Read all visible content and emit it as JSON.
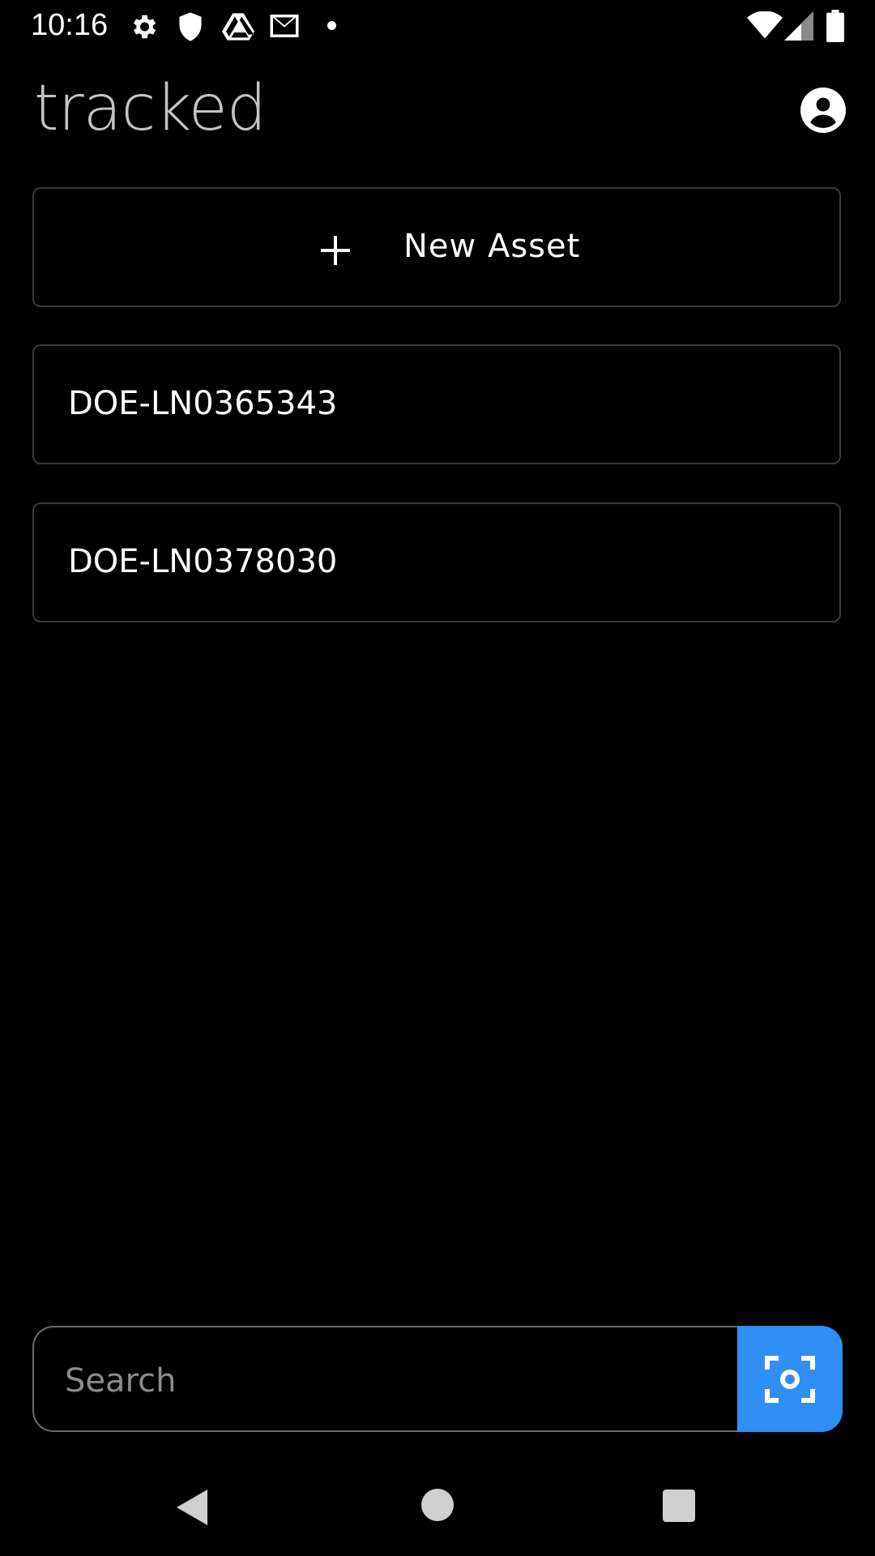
{
  "status_bar": {
    "time": "10:16",
    "left_icons": [
      "gear-icon",
      "shield-icon",
      "drive-icon",
      "gmail-icon",
      "dot-icon"
    ],
    "right_icons": [
      "wifi-icon",
      "signal-icon",
      "battery-icon"
    ]
  },
  "app_bar": {
    "title": "tracked",
    "profile_icon": "account-circle-icon"
  },
  "actions": {
    "new_asset_label": "New Asset",
    "new_asset_icon": "plus-icon"
  },
  "assets": [
    {
      "label": "DOE-LN0365343"
    },
    {
      "label": "DOE-LN0378030"
    }
  ],
  "search": {
    "placeholder": "Search",
    "value": "",
    "scan_icon": "scan-icon"
  },
  "colors": {
    "background": "#000000",
    "accent": "#2f8ff4",
    "card_border": "#3a3a3a",
    "title": "#c4c4c4"
  },
  "nav_bar": {
    "icons": [
      "back-icon",
      "home-icon",
      "recents-icon"
    ]
  }
}
